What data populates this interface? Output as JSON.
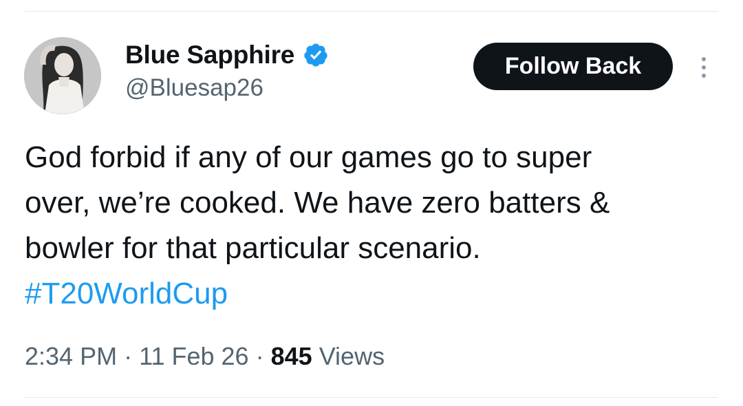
{
  "author": {
    "display_name": "Blue Sapphire",
    "handle": "@Bluesap26",
    "verified": true,
    "avatar_icon": "profile-photo"
  },
  "actions": {
    "follow_label": "Follow Back",
    "more_icon": "more-vertical-icon"
  },
  "tweet": {
    "text_lines": [
      "God forbid if any of our games go to super",
      "over, we’re cooked. We have zero batters &",
      "bowler for that particular scenario."
    ],
    "hashtag": "#T20WorldCup"
  },
  "meta": {
    "time": "2:34 PM",
    "separator": "·",
    "date": "11 Feb 26",
    "views_count": "845",
    "views_label": "Views"
  },
  "colors": {
    "text": "#0f1419",
    "secondary": "#536471",
    "accent": "#1d9bf0",
    "button_bg": "#0f1419"
  }
}
